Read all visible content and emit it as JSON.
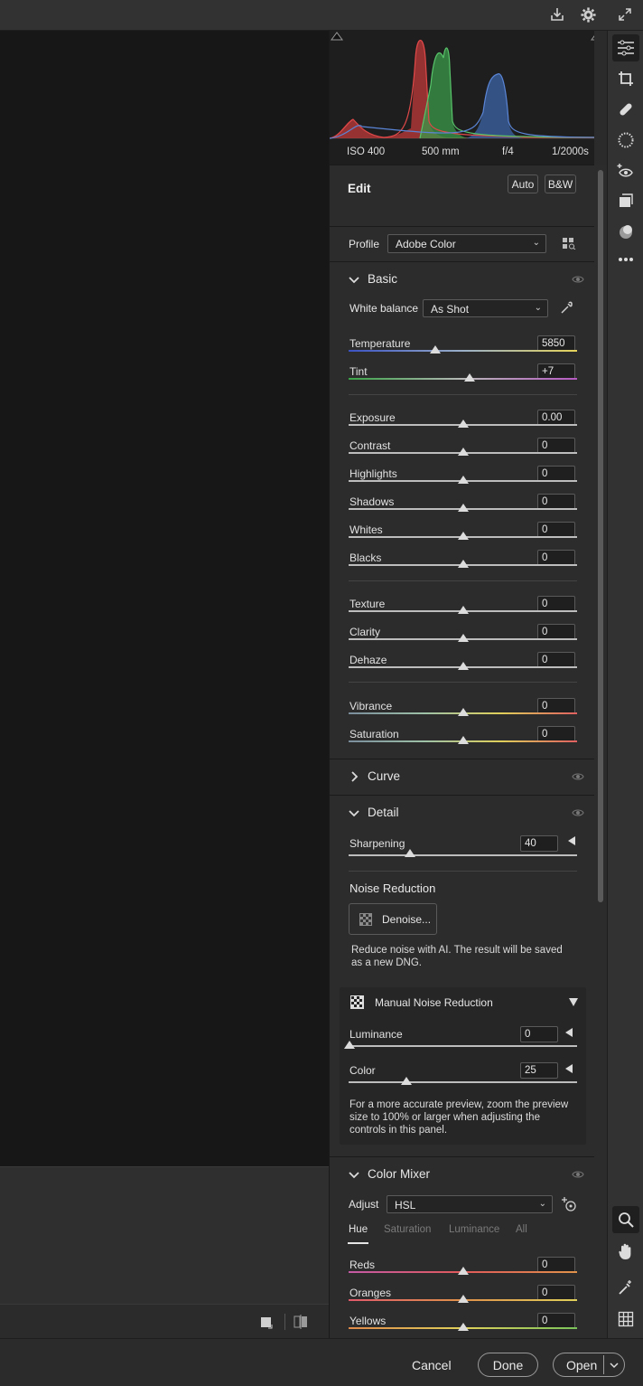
{
  "topbar": {
    "icons": [
      "save-icon",
      "gear-icon",
      "expand-icon"
    ]
  },
  "histogram": {
    "iso": "ISO 400",
    "focal": "500 mm",
    "aperture": "f/4",
    "shutter": "1/2000s"
  },
  "edit": {
    "title": "Edit",
    "auto_label": "Auto",
    "bw_label": "B&W",
    "profile_label": "Profile",
    "profile_value": "Adobe Color"
  },
  "basic": {
    "title": "Basic",
    "white_balance_label": "White balance",
    "white_balance_value": "As Shot",
    "sliders": [
      {
        "label": "Temperature",
        "value": "5850",
        "level": 0.38
      },
      {
        "label": "Tint",
        "value": "+7",
        "level": 0.53
      },
      {
        "label": "Exposure",
        "value": "0.00",
        "level": 0.5
      },
      {
        "label": "Contrast",
        "value": "0",
        "level": 0.5
      },
      {
        "label": "Highlights",
        "value": "0",
        "level": 0.5
      },
      {
        "label": "Shadows",
        "value": "0",
        "level": 0.5
      },
      {
        "label": "Whites",
        "value": "0",
        "level": 0.5
      },
      {
        "label": "Blacks",
        "value": "0",
        "level": 0.5
      },
      {
        "label": "Texture",
        "value": "0",
        "level": 0.5
      },
      {
        "label": "Clarity",
        "value": "0",
        "level": 0.5
      },
      {
        "label": "Dehaze",
        "value": "0",
        "level": 0.5
      },
      {
        "label": "Vibrance",
        "value": "0",
        "level": 0.5
      },
      {
        "label": "Saturation",
        "value": "0",
        "level": 0.5
      }
    ]
  },
  "curve": {
    "title": "Curve"
  },
  "detail": {
    "title": "Detail",
    "sharpening_label": "Sharpening",
    "sharpening_value": "40",
    "noise_title": "Noise Reduction",
    "denoise_label": "Denoise...",
    "denoise_desc_1": "Reduce noise with AI. The result will be saved",
    "denoise_desc_2": "as a new DNG.",
    "manual_title": "Manual Noise Reduction",
    "luminance_label": "Luminance",
    "luminance_value": "0",
    "color_label": "Color",
    "color_value": "25",
    "note_1": "For a more accurate preview, zoom the preview",
    "note_2": "size to 100% or larger when adjusting the",
    "note_3": "controls in this panel."
  },
  "color_mixer": {
    "title": "Color Mixer",
    "adjust_label": "Adjust",
    "adjust_value": "HSL",
    "tabs": [
      "Hue",
      "Saturation",
      "Luminance",
      "All"
    ],
    "rows": [
      {
        "label": "Reds",
        "value": "0"
      },
      {
        "label": "Oranges",
        "value": "0"
      },
      {
        "label": "Yellows",
        "value": "0"
      }
    ]
  },
  "footer": {
    "cancel": "Cancel",
    "done": "Done",
    "open": "Open"
  }
}
